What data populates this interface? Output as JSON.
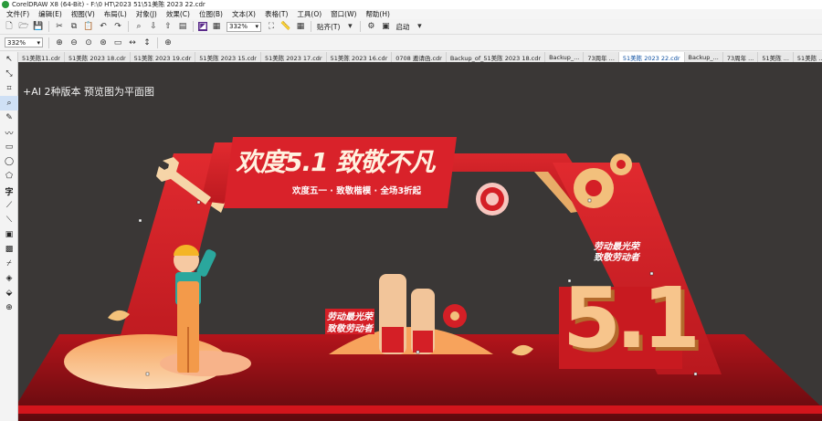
{
  "window": {
    "title": "CorelDRAW X8 (64-Bit) - F:\\0 HT\\2023 51\\51美陈 2023 22.cdr"
  },
  "menu": [
    "文件(F)",
    "编辑(E)",
    "视图(V)",
    "布局(L)",
    "对象(J)",
    "效果(C)",
    "位图(B)",
    "文本(X)",
    "表格(T)",
    "工具(O)",
    "窗口(W)",
    "帮助(H)"
  ],
  "toolbar": {
    "zoom_value": "332%",
    "snap_label": "贴齐(T)",
    "launch_label": "启动"
  },
  "propbar": {
    "zoom_value": "332%"
  },
  "tabs": [
    {
      "label": "51美陈11.cdr",
      "active": false
    },
    {
      "label": "51美陈 2023 18.cdr",
      "active": false
    },
    {
      "label": "51美陈 2023 19.cdr",
      "active": false
    },
    {
      "label": "51美陈 2023 15.cdr",
      "active": false
    },
    {
      "label": "51美陈 2023 17.cdr",
      "active": false
    },
    {
      "label": "51美陈 2023 16.cdr",
      "active": false
    },
    {
      "label": "0708 邀请函.cdr",
      "active": false
    },
    {
      "label": "Backup_of_51美陈 2023 18.cdr",
      "active": false
    },
    {
      "label": "Backup_...",
      "active": false
    },
    {
      "label": "73周年 ...",
      "active": false
    },
    {
      "label": "51美陈 2023 22.cdr",
      "active": true
    },
    {
      "label": "Backup_...",
      "active": false
    },
    {
      "label": "73周年 ...",
      "active": false
    },
    {
      "label": "51美陈 ...",
      "active": false
    },
    {
      "label": "51美陈 ...",
      "active": false
    }
  ],
  "canvas": {
    "note": "+AI 2种版本   预览图为平面图",
    "design": {
      "headline": "欢度5.1 致敬不凡",
      "subline": "欢度五一 · 致敬楷模 · 全场3折起",
      "slogan_right_1": "劳动最光荣",
      "slogan_right_2": "致敬劳动者",
      "slogan_center_1": "劳动最光荣",
      "slogan_center_2": "致敬劳动者",
      "big_number": "5.1"
    }
  },
  "colors": {
    "canvas_bg": "#3a3736",
    "arch_red": "#d41f26",
    "dark_red": "#9e1016",
    "gold": "#f3c27a",
    "cream": "#fbe3c1"
  }
}
